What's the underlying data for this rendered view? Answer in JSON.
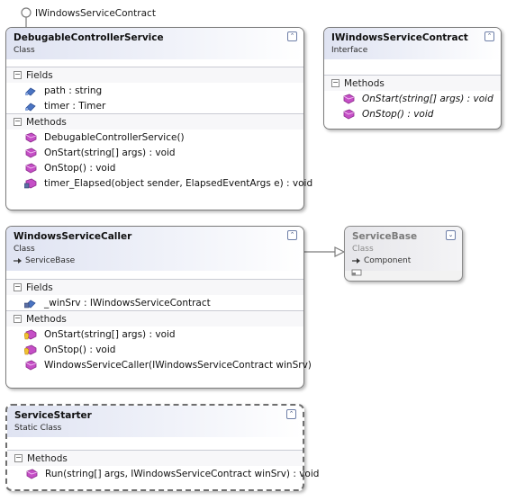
{
  "lollipop": {
    "label": "IWindowsServiceContract"
  },
  "shapes": {
    "debugable": {
      "title": "DebugableControllerService",
      "kind": "Class",
      "sections": {
        "fields_label": "Fields",
        "methods_label": "Methods"
      },
      "fields": [
        "path : string",
        "timer : Timer"
      ],
      "methods": [
        "DebugableControllerService()",
        "OnStart(string[] args) : void",
        "OnStop() : void",
        "timer_Elapsed(object sender, ElapsedEventArgs e) : void"
      ]
    },
    "iwsc": {
      "title": "IWindowsServiceContract",
      "kind": "Interface",
      "methods_label": "Methods",
      "methods": [
        "OnStart(string[] args) : void",
        "OnStop() : void"
      ]
    },
    "caller": {
      "title": "WindowsServiceCaller",
      "kind": "Class",
      "base": "ServiceBase",
      "fields_label": "Fields",
      "methods_label": "Methods",
      "fields": [
        "_winSrv : IWindowsServiceContract"
      ],
      "methods": [
        "OnStart(string[] args) : void",
        "OnStop() : void",
        "WindowsServiceCaller(IWindowsServiceContract winSrv)"
      ]
    },
    "servicebase": {
      "title": "ServiceBase",
      "kind": "Class",
      "base": "Component"
    },
    "starter": {
      "title": "ServiceStarter",
      "kind": "Static Class",
      "methods_label": "Methods",
      "methods": [
        "Run(string[] args, IWindowsServiceContract winSrv) : void"
      ]
    }
  },
  "icons": {
    "collapse": "double-chevron-up-icon",
    "expand": "double-chevron-down-icon",
    "field": "field-icon",
    "method": "method-icon",
    "protected_method": "protected-method-icon",
    "inheritance": "inheritance-arrow-icon"
  }
}
